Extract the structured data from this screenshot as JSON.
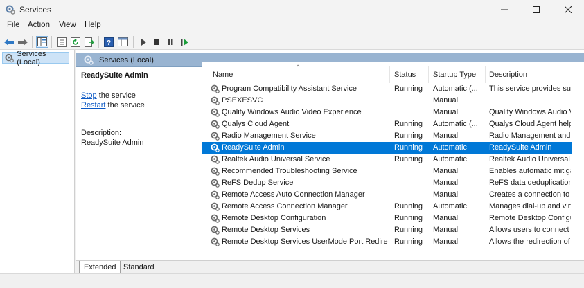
{
  "window": {
    "title": "Services"
  },
  "menu": [
    "File",
    "Action",
    "View",
    "Help"
  ],
  "tree": {
    "root_label": "Services (Local)"
  },
  "details": {
    "header_label": "Services (Local)",
    "selected_service": "ReadySuite Admin",
    "actions": [
      {
        "link": "Stop",
        "text": " the service"
      },
      {
        "link": "Restart",
        "text": " the service"
      }
    ],
    "description_label": "Description:",
    "description_value": "ReadySuite Admin"
  },
  "columns": {
    "name": "Name",
    "status": "Status",
    "startup_type": "Startup Type",
    "description": "Description"
  },
  "services": [
    {
      "name": "Program Compatibility Assistant Service",
      "status": "Running",
      "startup": "Automatic (...",
      "description": "This service provides supp"
    },
    {
      "name": "PSEXESVC",
      "status": "",
      "startup": "Manual",
      "description": ""
    },
    {
      "name": "Quality Windows Audio Video Experience",
      "status": "",
      "startup": "Manual",
      "description": "Quality Windows Audio V"
    },
    {
      "name": "Qualys Cloud Agent",
      "status": "Running",
      "startup": "Automatic (...",
      "description": "Qualys Cloud Agent helps"
    },
    {
      "name": "Radio Management Service",
      "status": "Running",
      "startup": "Manual",
      "description": "Radio Management and A"
    },
    {
      "name": "ReadySuite Admin",
      "status": "Running",
      "startup": "Automatic",
      "description": "ReadySuite Admin",
      "selected": true
    },
    {
      "name": "Realtek Audio Universal Service",
      "status": "Running",
      "startup": "Automatic",
      "description": "Realtek Audio Universal S"
    },
    {
      "name": "Recommended Troubleshooting Service",
      "status": "",
      "startup": "Manual",
      "description": "Enables automatic mitiga"
    },
    {
      "name": "ReFS Dedup Service",
      "status": "",
      "startup": "Manual",
      "description": "ReFS data deduplication a"
    },
    {
      "name": "Remote Access Auto Connection Manager",
      "status": "",
      "startup": "Manual",
      "description": "Creates a connection to a"
    },
    {
      "name": "Remote Access Connection Manager",
      "status": "Running",
      "startup": "Automatic",
      "description": "Manages dial-up and virt"
    },
    {
      "name": "Remote Desktop Configuration",
      "status": "Running",
      "startup": "Manual",
      "description": "Remote Desktop Configu"
    },
    {
      "name": "Remote Desktop Services",
      "status": "Running",
      "startup": "Manual",
      "description": "Allows users to connect ir"
    },
    {
      "name": "Remote Desktop Services UserMode Port Redirect...",
      "status": "Running",
      "startup": "Manual",
      "description": "Allows the redirection of I"
    }
  ],
  "tabs": {
    "extended": "Extended",
    "standard": "Standard"
  },
  "colors": {
    "selection": "#0078d7",
    "header_band": "#99b4d1",
    "link": "#0b58c4",
    "play_icon": "#1a9e3a"
  },
  "icons": [
    "back-arrow-icon",
    "forward-arrow-icon",
    "show-hide-tree-icon",
    "properties-icon",
    "refresh-icon",
    "export-icon",
    "help-icon",
    "console-icon",
    "start-icon",
    "stop-icon",
    "pause-icon",
    "restart-icon",
    "gear-icon"
  ]
}
